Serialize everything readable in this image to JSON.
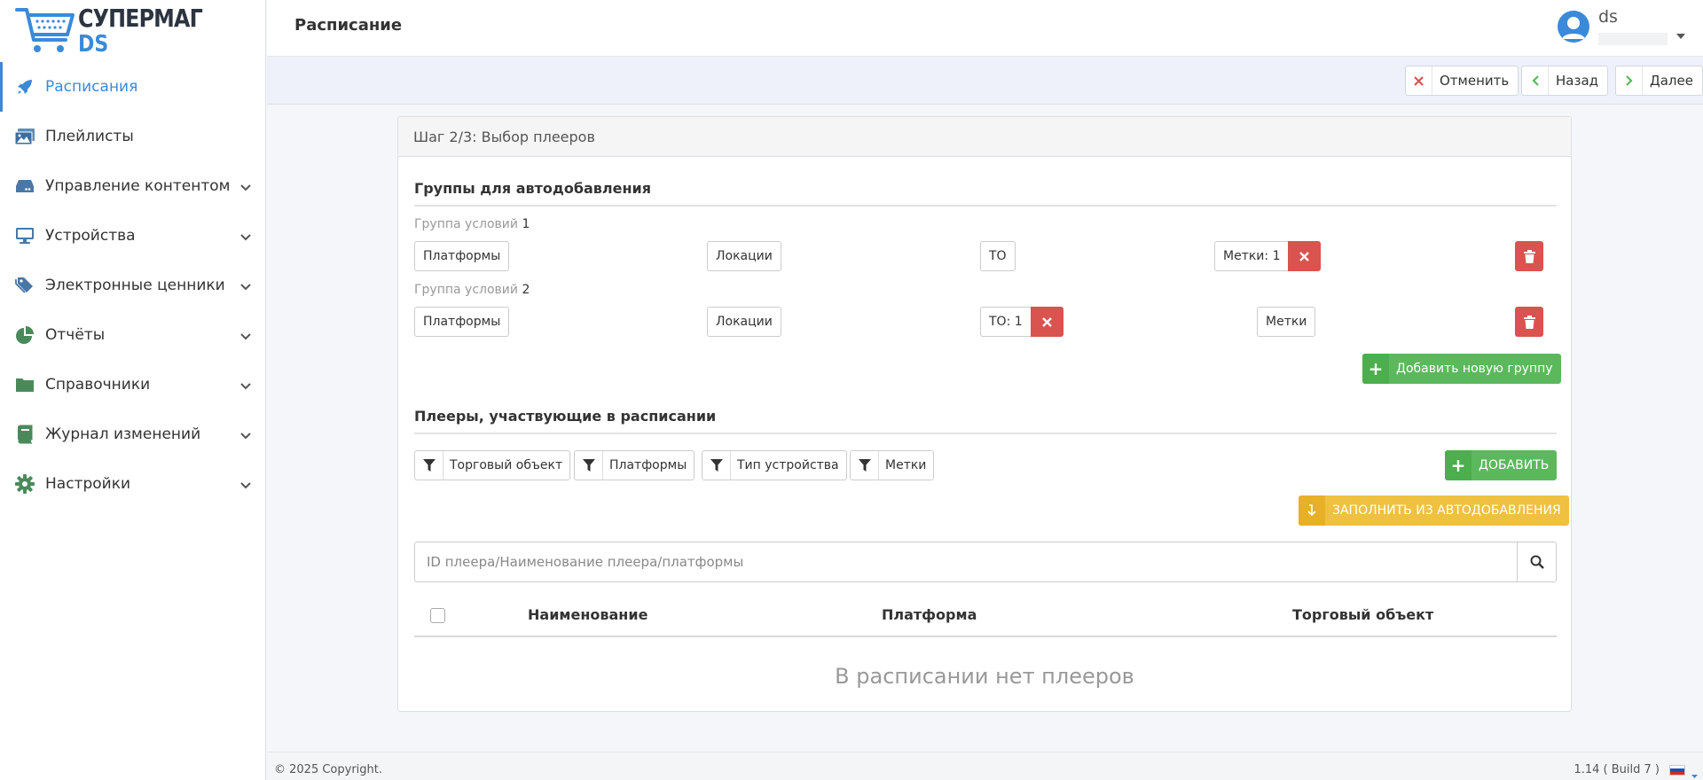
{
  "brand": {
    "line1": "СУПЕРМАГ",
    "line2": "DS"
  },
  "colors": {
    "accent": "#3b8ad9",
    "green": "#5cb85c",
    "red": "#d9534f",
    "yellow": "#f0c040"
  },
  "sidebar": {
    "items": [
      {
        "label": "Расписания",
        "icon": "rocket-icon",
        "active": true
      },
      {
        "label": "Плейлисты",
        "icon": "images-icon"
      },
      {
        "label": "Управление контентом",
        "icon": "hdd-icon"
      },
      {
        "label": "Устройства",
        "icon": "monitor-icon"
      },
      {
        "label": "Электронные ценники",
        "icon": "tags-icon"
      },
      {
        "label": "Отчёты",
        "icon": "pie-chart-icon"
      },
      {
        "label": "Справочники",
        "icon": "folder-icon"
      },
      {
        "label": "Журнал изменений",
        "icon": "book-icon"
      },
      {
        "label": "Настройки",
        "icon": "gear-icon"
      }
    ]
  },
  "header": {
    "title": "Расписание",
    "user": "ds"
  },
  "toolbar": {
    "cancel": "Отменить",
    "back": "Назад",
    "next": "Далее"
  },
  "card": {
    "title": "Шаг 2/3: Выбор плееров",
    "autogroups_title": "Группы для автодобавления",
    "group_label": "Группа условий",
    "groups": [
      {
        "num": "1",
        "platforms": "Платформы",
        "locations": "Локации",
        "to": "ТО",
        "tags": "Метки: 1"
      },
      {
        "num": "2",
        "platforms": "Платформы",
        "locations": "Локации",
        "to": "ТО: 1",
        "tags": "Метки"
      }
    ],
    "add_group": "Добавить новую группу",
    "players_title": "Плееры, участвующие в расписании",
    "filters": [
      "Торговый объект",
      "Платформы",
      "Тип устройства",
      "Метки"
    ],
    "add": "ДОБАВИТЬ",
    "fill_auto": "ЗАПОЛНИТЬ ИЗ АВТОДОБАВЛЕНИЯ",
    "search_placeholder": "ID плеера/Наименование плеера/платформы",
    "columns": [
      "Наименование",
      "Платформа",
      "Торговый объект"
    ],
    "empty": "В расписании нет плееров"
  },
  "footer": {
    "copyright": "© 2025 Copyright.",
    "build": "1.14 ( Build 7 )"
  }
}
